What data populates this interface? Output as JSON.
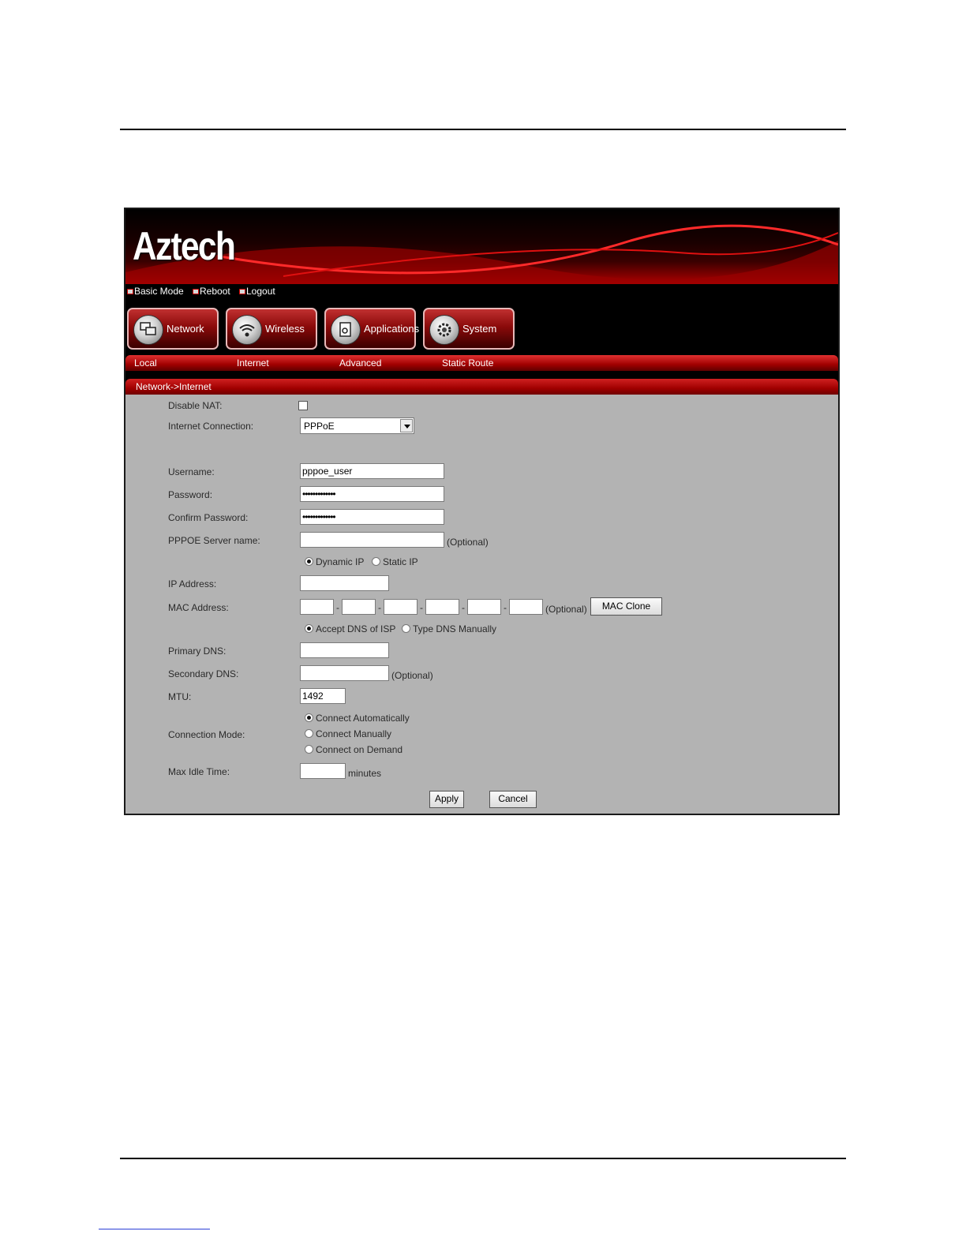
{
  "app": {
    "logo": "Aztech"
  },
  "toplinks": [
    {
      "label": "Basic Mode"
    },
    {
      "label": "Reboot"
    },
    {
      "label": "Logout"
    }
  ],
  "nav": [
    {
      "label": "Network",
      "icon": "network-icon"
    },
    {
      "label": "Wireless",
      "icon": "wireless-icon"
    },
    {
      "label": "Applications",
      "icon": "applications-icon"
    },
    {
      "label": "System",
      "icon": "system-icon"
    }
  ],
  "subnav": [
    {
      "label": "Local"
    },
    {
      "label": "Internet"
    },
    {
      "label": "Advanced"
    },
    {
      "label": "Static Route"
    }
  ],
  "breadcrumb": "Network->Internet",
  "form": {
    "disable_nat_label": "Disable NAT:",
    "internet_connection_label": "Internet Connection:",
    "internet_connection_value": "PPPoE",
    "username_label": "Username:",
    "username_value": "pppoe_user",
    "password_label": "Password:",
    "password_value": "•••••••••••••",
    "confirm_password_label": "Confirm Password:",
    "confirm_password_value": "•••••••••••••",
    "pppoe_server_label": "PPPOE Server name:",
    "pppoe_server_value": "",
    "optional": "(Optional)",
    "dynamic_ip": "Dynamic IP",
    "static_ip": "Static IP",
    "ip_address_label": "IP Address:",
    "mac_address_label": "MAC Address:",
    "mac_sep": "-",
    "mac_clone": "MAC Clone",
    "accept_dns": "Accept DNS of ISP",
    "type_dns": "Type DNS Manually",
    "primary_dns_label": "Primary DNS:",
    "secondary_dns_label": "Secondary DNS:",
    "mtu_label": "MTU:",
    "mtu_value": "1492",
    "connection_mode_label": "Connection Mode:",
    "connect_auto": "Connect Automatically",
    "connect_manual": "Connect Manually",
    "connect_demand": "Connect on Demand",
    "max_idle_label": "Max Idle Time:",
    "minutes": "minutes",
    "apply": "Apply",
    "cancel": "Cancel"
  },
  "colors": {
    "accent": "#b00000",
    "panel": "#b3b3b3"
  }
}
